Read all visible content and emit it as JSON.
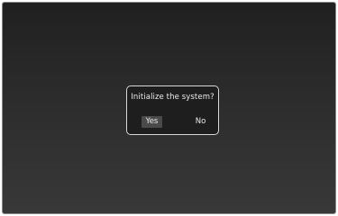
{
  "dialog": {
    "message": "Initialize the system?",
    "buttons": {
      "yes_label": "Yes",
      "no_label": "No",
      "selected": "Yes"
    }
  },
  "colors": {
    "background_top": "#202020",
    "background_bottom": "#383838",
    "dialog_background": "#1e1e1e",
    "dialog_border": "#d8d8d8",
    "selected_button": "#4a4a4a",
    "text": "#ececec"
  }
}
